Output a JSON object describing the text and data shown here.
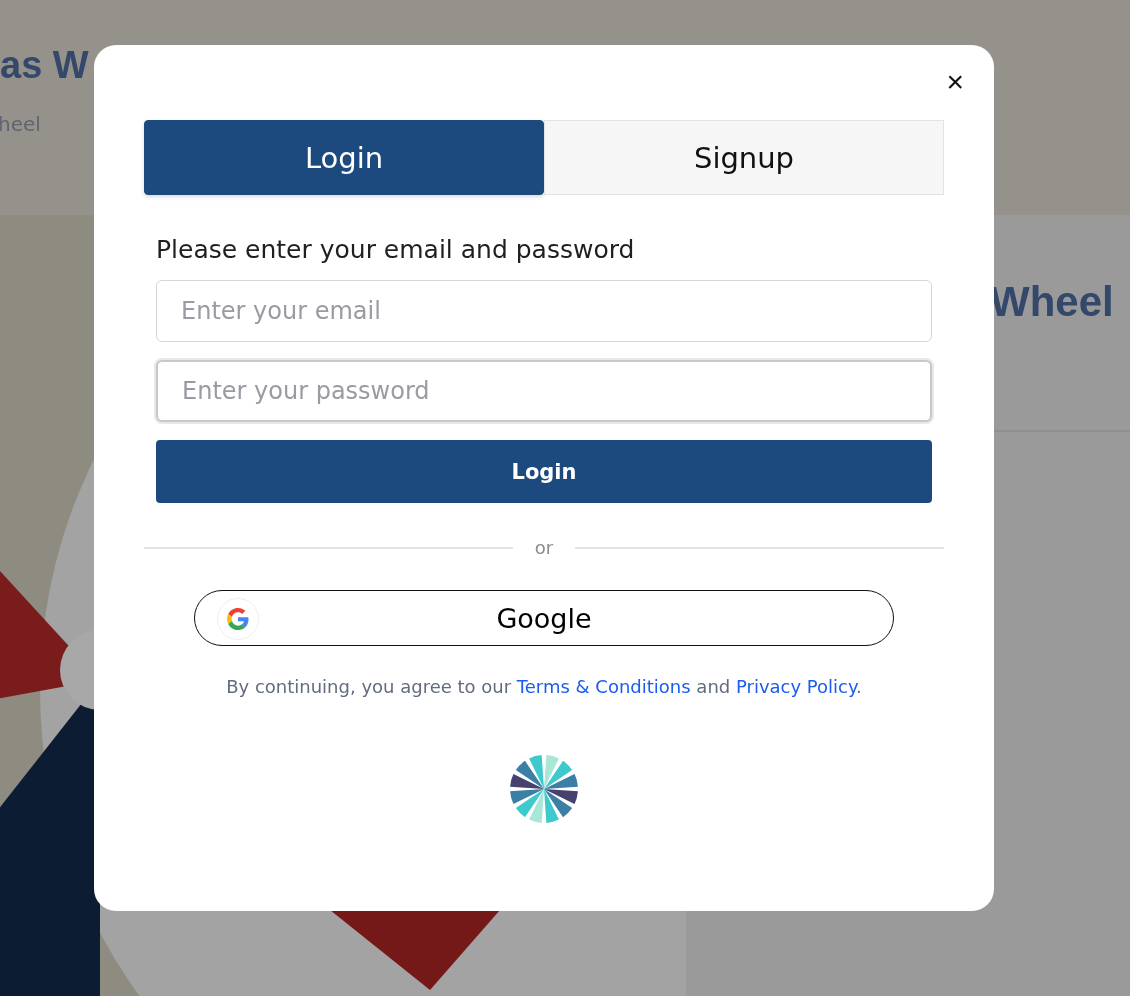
{
  "background": {
    "title": "as W",
    "subtitle": "heel",
    "card_title": "Wheel"
  },
  "modal": {
    "close": "×",
    "tabs": [
      {
        "label": "Login",
        "selected": true
      },
      {
        "label": "Signup",
        "selected": false
      }
    ],
    "prompt": "Please enter your email and password",
    "fields": [
      {
        "placeholder": "Enter your email",
        "focused": false
      },
      {
        "placeholder": "Enter your password",
        "focused": true
      }
    ],
    "submit": "Login",
    "divider": "or",
    "google": "Google",
    "legal": {
      "before": "By continuing, you agree to our",
      "terms": "Terms & Conditions",
      "middle": "and",
      "privacy": "Privacy Policy",
      "after": "."
    }
  }
}
